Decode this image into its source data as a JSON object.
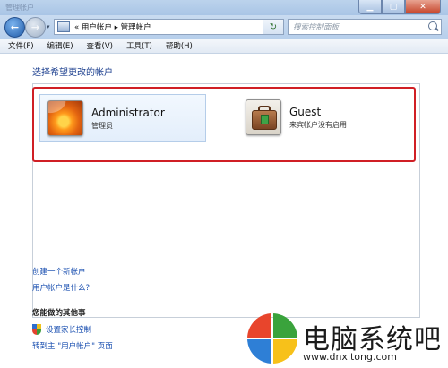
{
  "window": {
    "title": "管理帐户"
  },
  "nav": {
    "breadcrumb": "« 用户帐户 ▸ 管理帐户",
    "search_placeholder": "搜索控制面板"
  },
  "menu": [
    "文件(F)",
    "编辑(E)",
    "查看(V)",
    "工具(T)",
    "帮助(H)"
  ],
  "main": {
    "heading": "选择希望更改的帐户",
    "accounts": [
      {
        "name": "Administrator",
        "subtitle": "管理员",
        "icon": "flower-avatar-icon"
      },
      {
        "name": "Guest",
        "subtitle": "来宾帐户没有启用",
        "icon": "briefcase-avatar-icon"
      }
    ],
    "links": {
      "create": "创建一个新帐户",
      "what_is": "用户帐户是什么?"
    },
    "other": {
      "title": "您能做的其他事",
      "parental": "设置家长控制",
      "goto": "转到主 \"用户帐户\" 页面"
    }
  },
  "watermark": {
    "text": "电脑系统吧",
    "url": "www.dnxitong.com"
  },
  "colors": {
    "highlight_border": "#d01f25",
    "link": "#1a4fb0",
    "heading": "#1c3f8f"
  }
}
